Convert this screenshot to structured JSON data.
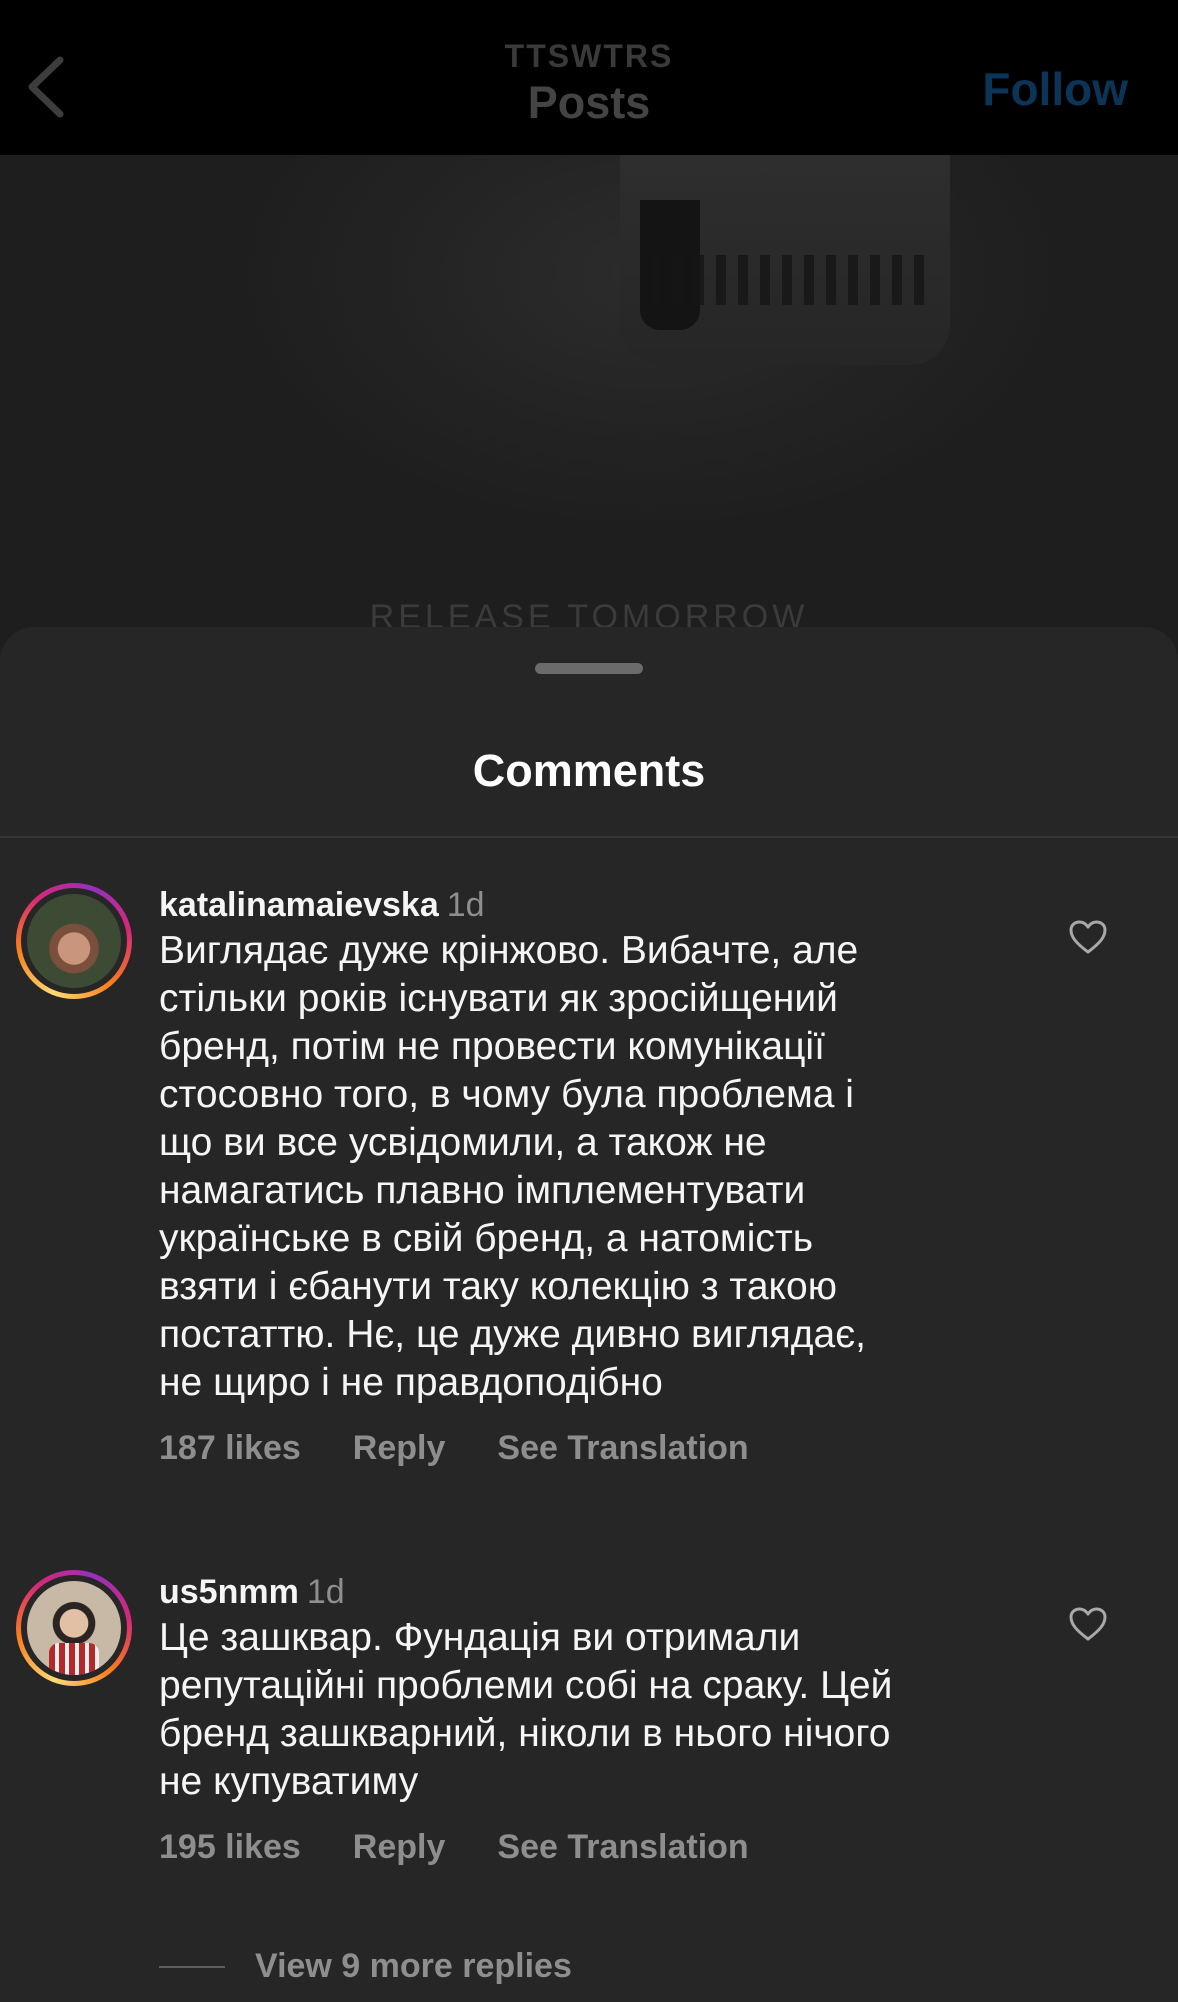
{
  "header": {
    "username": "TTSWTRS",
    "title": "Posts",
    "follow_label": "Follow",
    "icons": {
      "back": "chevron-left-icon"
    }
  },
  "post": {
    "caption_overlay": "RELEASE TOMORROW"
  },
  "sheet": {
    "title": "Comments"
  },
  "comments": [
    {
      "username": "katalinamaievska",
      "time": "1d",
      "text": "Виглядає дуже крінжово. Вибачте, але\nстільки років існувати як зросійщений\nбренд, потім не провести комунікації\nстосовно того, в чому була проблема і\nщо ви все усвідомили, а також не\nнамагатись плавно імплементувати\nукраїнське в свій бренд, а натомість\nвзяти і єбанути таку колекцію з такою\nпостаттю. Нє, це дуже дивно виглядає,\nне щиро і не правдоподібно",
      "likes": "187 likes",
      "reply": "Reply",
      "translate": "See Translation"
    },
    {
      "username": "us5nmm",
      "time": "1d",
      "text": "Це зашквар. Фундація ви отримали\nрепутаційні проблеми собі на сраку. Цей\nбренд зашкварний, ніколи в нього нічого\nне купуватиму",
      "likes": "195 likes",
      "reply": "Reply",
      "translate": "See Translation"
    }
  ],
  "more_replies": "View 9 more replies",
  "colors": {
    "sheet_bg": "#262626",
    "secondary_text": "#8e8e8e",
    "follow_blue": "#0b3456"
  }
}
